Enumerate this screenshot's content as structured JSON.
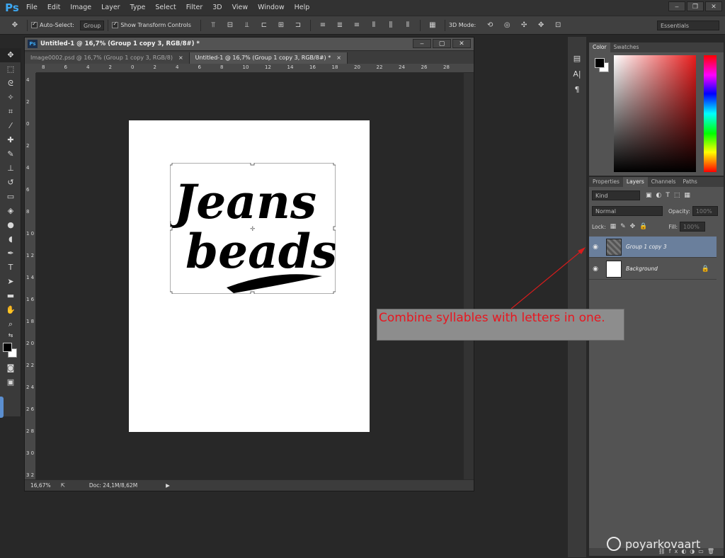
{
  "app": {
    "logo": "Ps"
  },
  "menu": [
    "File",
    "Edit",
    "Image",
    "Layer",
    "Type",
    "Select",
    "Filter",
    "3D",
    "View",
    "Window",
    "Help"
  ],
  "window_controls": {
    "minimize": "‒",
    "restore": "❐",
    "close": "✕"
  },
  "options_bar": {
    "auto_select_label": "Auto-Select:",
    "auto_select_value": "Group",
    "show_transform_label": "Show Transform Controls",
    "mode_3d_label": "3D Mode:",
    "workspace": "Essentials"
  },
  "document": {
    "title": "Untitled-1 @ 16,7% (Group 1 copy 3, RGB/8#) *",
    "tabs": [
      {
        "label": "Image0002.psd @ 16,7% (Group 1 copy 3, RGB/8)",
        "close": "×"
      },
      {
        "label": "Untitled-1 @ 16,7% (Group 1 copy 3, RGB/8#) *",
        "close": "×"
      }
    ],
    "ruler_h": [
      "8",
      "6",
      "4",
      "2",
      "0",
      "2",
      "4",
      "6",
      "8",
      "10",
      "12",
      "14",
      "16",
      "18",
      "20",
      "22",
      "24",
      "26",
      "28"
    ],
    "ruler_v": [
      "4",
      "2",
      "0",
      "2",
      "4",
      "6",
      "8",
      "1 0",
      "1 2",
      "1 4",
      "1 6",
      "1 8",
      "2 0",
      "2 2",
      "2 4",
      "2 6",
      "2 8",
      "3 0",
      "3 2"
    ],
    "status_zoom": "16,67%",
    "status_doc": "Doc: 24,1M/8,62M",
    "artwork_text_line1": "Jeans",
    "artwork_text_line2": "beads"
  },
  "annotation": {
    "text": "Combine syllables with letters in one.",
    "color": "#e8161f"
  },
  "color_panel": {
    "tabs": [
      "Color",
      "Swatches"
    ]
  },
  "layers_panel": {
    "tabs": [
      "Properties",
      "Layers",
      "Channels",
      "Paths"
    ],
    "filter_kind": "Kind",
    "blend_mode": "Normal",
    "opacity_label": "Opacity:",
    "opacity_value": "100%",
    "lock_label": "Lock:",
    "fill_label": "Fill:",
    "fill_value": "100%",
    "layers": [
      {
        "name": "Group 1 copy 3",
        "selected": true
      },
      {
        "name": "Background",
        "selected": false,
        "locked": true
      }
    ]
  },
  "watermark": "poyarkovaart"
}
